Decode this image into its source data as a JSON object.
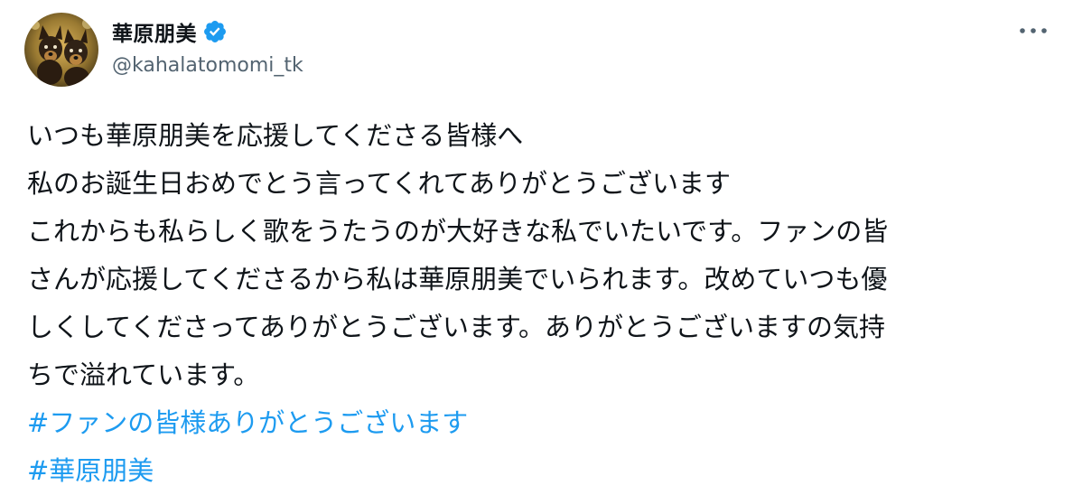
{
  "user": {
    "display_name": "華原朋美",
    "handle": "@kahalatomomi_tk",
    "verified": true,
    "avatar_icon": "avatar-dogs-photo"
  },
  "tweet": {
    "lines": [
      "いつも華原朋美を応援してくださる皆様へ",
      "私のお誕生日おめでとう言ってくれてありがとうございます",
      "これからも私らしく歌をうたうのが大好きな私でいたいです。ファンの皆",
      "さんが応援してくださるから私は華原朋美でいられます。改めていつも優",
      "しくしてくださってありがとうございます。ありがとうございますの気持",
      "ちで溢れています。"
    ],
    "hashtags": [
      "#ファンの皆様ありがとうございます",
      "#華原朋美"
    ]
  },
  "icons": {
    "verified": "verified-badge-icon",
    "more": "more-options-icon"
  },
  "colors": {
    "text": "#0f1419",
    "secondary": "#536471",
    "link": "#1d9bf0",
    "verified": "#1d9bf0"
  }
}
